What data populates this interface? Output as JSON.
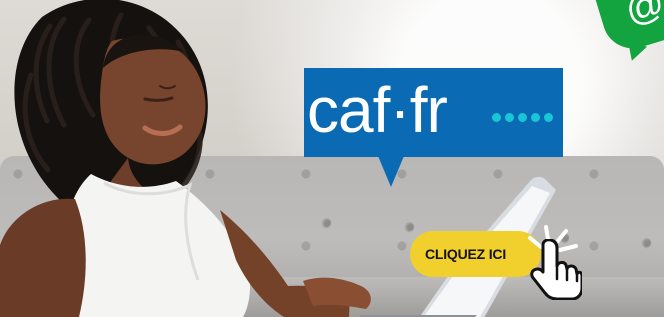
{
  "ad": {
    "brand_logo_text": "caf·fr",
    "button_label": "CLIQUEZ ICI",
    "corner_symbol": "@",
    "icons": {
      "logo_dots": "logo-dots-icon",
      "corner_badge": "at-chat-icon",
      "hand": "pointing-hand-icon",
      "rays": "click-rays-icon"
    },
    "colors": {
      "brand_blue": "#0a6bb4",
      "accent_cyan": "#18c6d5",
      "cta_yellow": "#f1cf2d",
      "corner_green": "#13a33f"
    }
  }
}
